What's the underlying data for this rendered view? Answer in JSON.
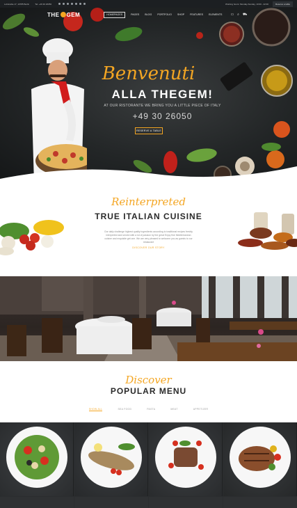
{
  "topbar": {
    "address": "Lohstraße 17, 10785 Berlin",
    "phone": "Tel: +49 30 26050",
    "hours": "Working hours: Monday-Sunday, 10:00 - 22:00",
    "reserve": "Reserve a table"
  },
  "nav": {
    "logo_left": "THE",
    "logo_right": "GEM",
    "items": [
      "HOMEPAGES",
      "PAGES",
      "BLOG",
      "PORTFOLIO",
      "SHOP",
      "FEATURES",
      "ELEMENTS"
    ]
  },
  "hero": {
    "script": "Benvenuti",
    "title": "ALLA THEGEM!",
    "subtitle": "AT OUR RISTORANTE WE BRING YOU A LITTLE PIECE OF ITALY",
    "phone": "+49 30 26050",
    "button": "RESERVE A TABLE"
  },
  "intro": {
    "script": "Reinterpreted",
    "title": "TRUE ITALIAN CUISINE",
    "text": "Our daily challenge highest quality ingredients according to traditional recipes freshly interpreted and served with a lot of passion by the great Enjoy fine Mediterranean cuisine and exquisite get one. We are very pleased to welcome you as guests to our restaurant",
    "link": "DISCOVER OUR STORY"
  },
  "menu": {
    "script": "Discover",
    "title": "POPULAR MENU",
    "filters": [
      "SHOW ALL",
      "SEA FOOD",
      "PASTA",
      "MEAT",
      "APPETIZER"
    ]
  },
  "colors": {
    "accent": "#f4a623",
    "dark": "#1c1f22"
  }
}
